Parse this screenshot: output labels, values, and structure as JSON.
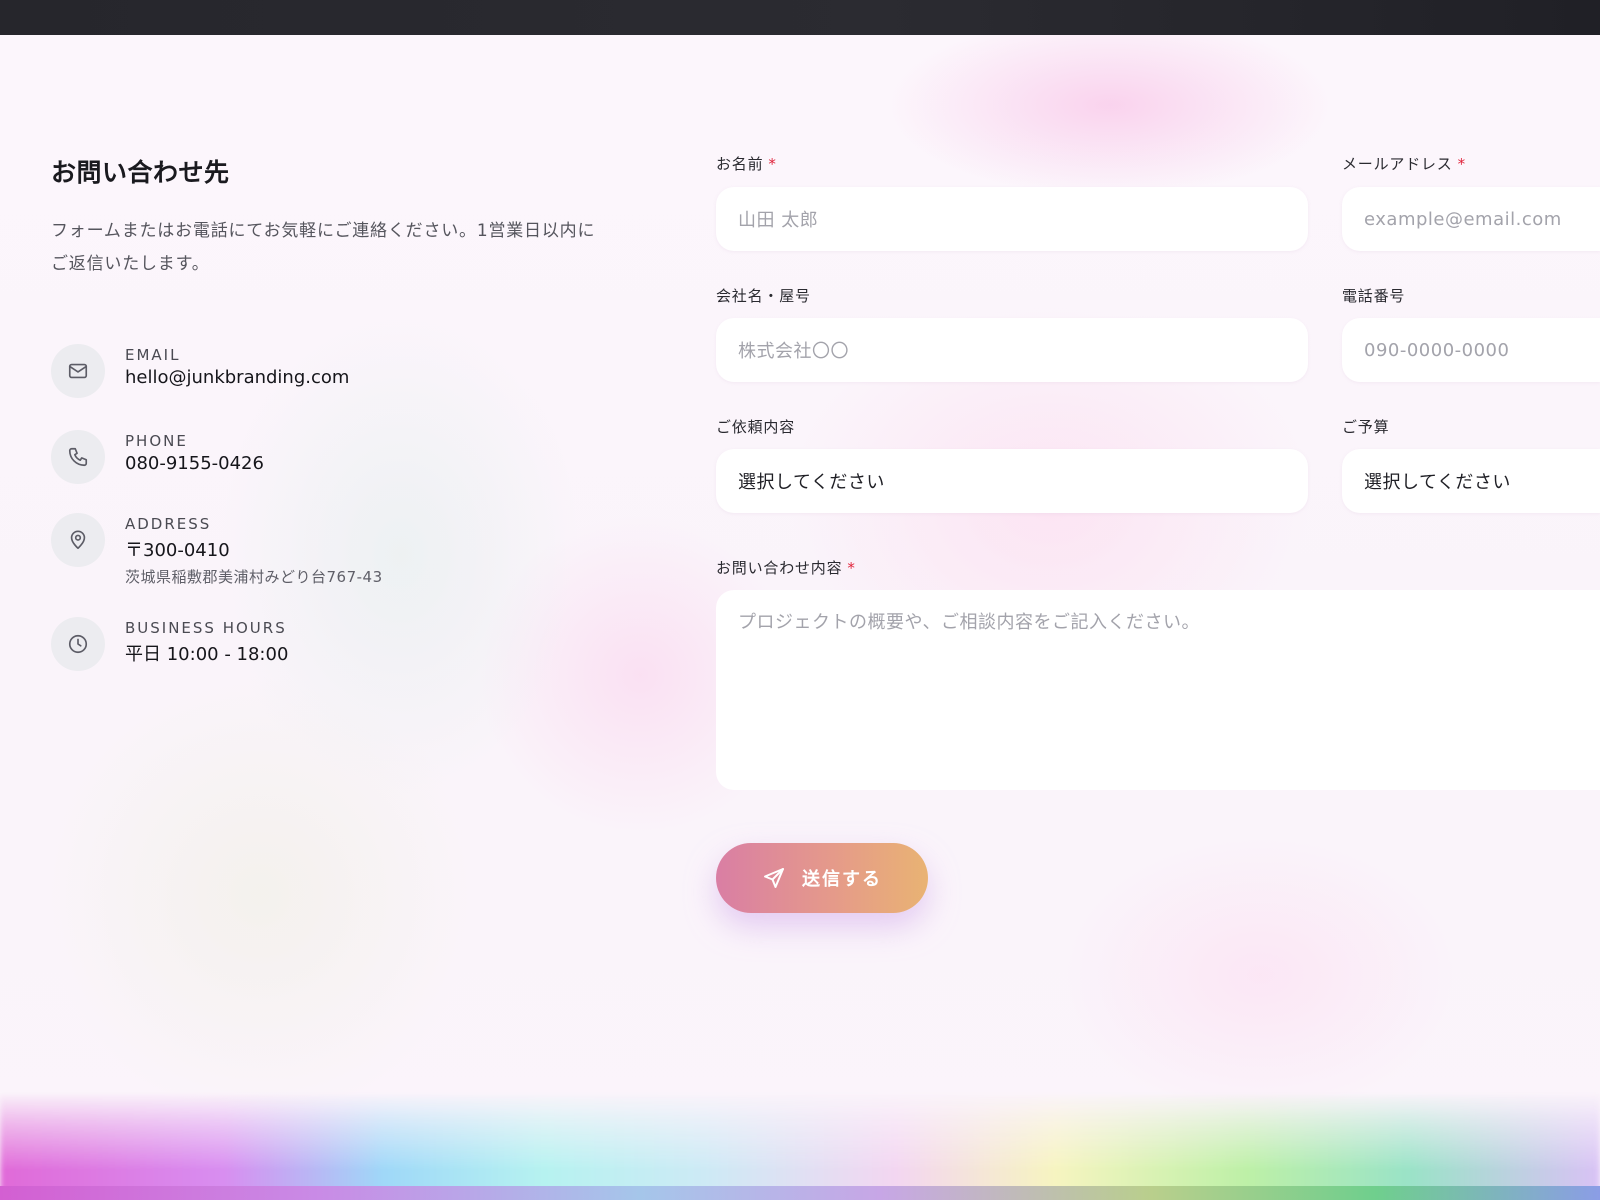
{
  "contact": {
    "title": "お問い合わせ先",
    "description": "フォームまたはお電話にてお気軽にご連絡ください。1営業日以内にご返信いたします。",
    "items": [
      {
        "label": "EMAIL",
        "value": "hello@junkbranding.com",
        "icon": "mail-icon"
      },
      {
        "label": "PHONE",
        "value": "080-9155-0426",
        "icon": "phone-icon"
      },
      {
        "label": "ADDRESS",
        "value": "〒300-0410",
        "sub": "茨城県稲敷郡美浦村みどり台767-43",
        "icon": "map-pin-icon"
      },
      {
        "label": "BUSINESS HOURS",
        "value": "平日 10:00 - 18:00",
        "icon": "clock-icon"
      }
    ]
  },
  "form": {
    "name": {
      "label": "お名前",
      "required_mark": "*",
      "placeholder": "山田 太郎"
    },
    "email": {
      "label": "メールアドレス",
      "required_mark": "*",
      "placeholder": "example@email.com"
    },
    "company": {
      "label": "会社名・屋号",
      "placeholder": "株式会社〇〇"
    },
    "phone": {
      "label": "電話番号",
      "placeholder": "090-0000-0000"
    },
    "request": {
      "label": "ご依頼内容",
      "value": "選択してください"
    },
    "budget": {
      "label": "ご予算",
      "value": "選択してください"
    },
    "message": {
      "label": "お問い合わせ内容",
      "required_mark": "*",
      "placeholder": "プロジェクトの概要や、ご相談内容をご記入ください。"
    },
    "submit_label": "送信する",
    "submit_icon": "send-icon"
  },
  "colors": {
    "required": "#e0243b",
    "button_gradient_start": "#d97ea4",
    "button_gradient_end": "#e9b373",
    "topbar": "#26262c"
  }
}
